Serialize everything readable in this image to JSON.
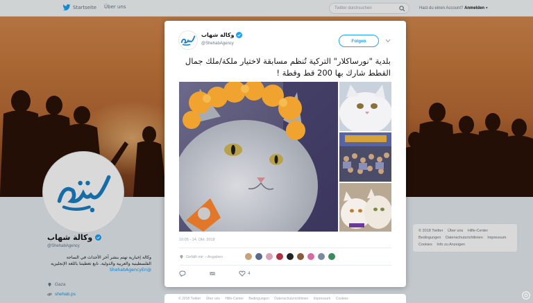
{
  "nav": {
    "home": "Startseite",
    "about": "Über uns",
    "search_placeholder": "Twitter durchsuchen",
    "account_question": "Hast du einen Account?",
    "login": "Anmelden"
  },
  "profile": {
    "name": "وكالة شهاب",
    "handle": "@ShehabAgency",
    "bio": "وكالة إخبارية تهتم بنشر آخر الأحداث في الساحة الفلسطينية والعربية والدولية. تابع تغطيتنا باللغة الإنجليزية",
    "bio_link": "@ShehabAgencyEn",
    "location": "Gaza",
    "url": "shehab.ps"
  },
  "footer": {
    "links": [
      "© 2018 Twitter",
      "Über uns",
      "Hilfe-Center",
      "Bedingungen",
      "Datenschutzrichtlinien",
      "Impressum",
      "Cookies",
      "Info zu Anzeigen"
    ]
  },
  "tweet": {
    "name": "وكالة شهاب",
    "handle": "@ShehabAgency",
    "follow_label": "Folgen",
    "text": "بلدية \"نورساكلار\" التركية تُنظم مسابقة لاختيار ملكة/ملك جمال القطط شارك بها 200 قط وقطة !",
    "timestamp": "10:05 - 14. Okt. 2018",
    "location_label": "Gefällt mir – Angaben",
    "reply_count": "",
    "retweet_count": "",
    "like_count": "4"
  },
  "under_strip": {
    "links": [
      "© 2018 Twitter",
      "Über uns",
      "Hilfe-Center",
      "Bedingungen",
      "Datenschutzrichtlinien",
      "Impressum",
      "Cookies"
    ]
  },
  "colors": {
    "accent": "#1da1f2",
    "banner": "#c77a3e",
    "logo": "#1b7fc4"
  }
}
